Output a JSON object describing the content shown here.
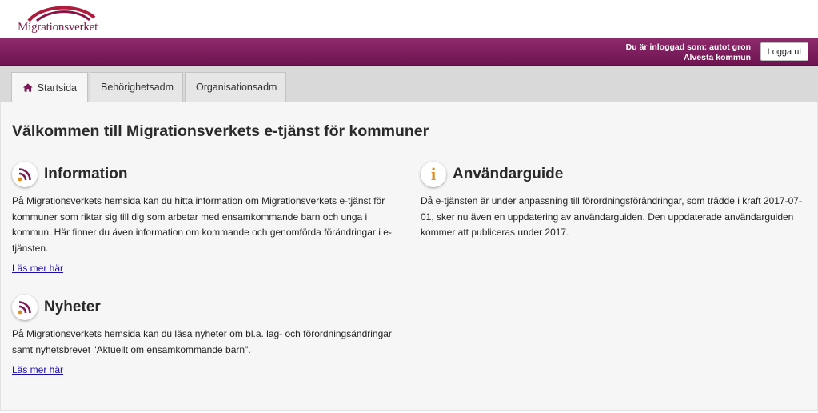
{
  "header": {
    "logo_text": "Migrationsverket",
    "logged_in_label": "Du är inloggad som: autot gron",
    "organization": "Alvesta kommun",
    "logout_label": "Logga ut"
  },
  "tabs": [
    {
      "label": "Startsida",
      "icon": "home-icon",
      "active": true
    },
    {
      "label": "Behörighetsadm",
      "active": false
    },
    {
      "label": "Organisationsadm",
      "active": false
    }
  ],
  "main": {
    "title": "Välkommen till Migrationsverkets e-tjänst för kommuner",
    "information": {
      "icon": "rss-icon",
      "title": "Information",
      "body": "På Migrationsverkets hemsida kan du hitta information om Migrationsverkets e-tjänst för kommuner som riktar sig till dig som arbetar med ensamkommande barn och unga i kommun. Här finner du även information om kommande och genomförda förändringar i e-tjänsten.",
      "link": "Läs mer här"
    },
    "nyheter": {
      "icon": "rss-icon",
      "title": "Nyheter",
      "body": "På Migrationsverkets hemsida kan du läsa nyheter om bl.a. lag- och förordningsändringar samt nyhetsbrevet \"Aktuellt om ensamkommande barn\".",
      "link": "Läs mer här"
    },
    "anvandarguide": {
      "icon": "info-icon",
      "icon_letter": "i",
      "title": "Användarguide",
      "body": "Då e-tjänsten är under anpassning till förordningsförändringar, som trädde i kraft 2017-07-01, sker nu även en uppdatering av användarguiden. Den uppdaterade användarguiden kommer att publiceras under 2017."
    }
  },
  "colors": {
    "brand_purple": "#7a1a55",
    "link": "#1a0dab",
    "info_orange": "#e08a17"
  }
}
